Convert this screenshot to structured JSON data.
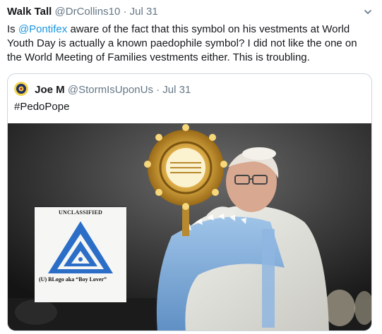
{
  "tweet": {
    "author_name": "Walk Tall",
    "author_handle": "@DrCollins10",
    "separator": "·",
    "date": "Jul 31",
    "text_before": "Is ",
    "mention": "@Pontifex",
    "text_after": " aware of the fact that this symbol on his vestments at World Youth Day is actually a known paedophile symbol? I did not like the one on the World Meeting of Families vestments either. This is troubling."
  },
  "quoted": {
    "author_name": "Joe M",
    "author_handle": "@StormIsUponUs",
    "separator": "·",
    "date": "Jul 31",
    "text": "#PedoPope",
    "image": {
      "placard_top": "UNCLASSIFIED",
      "placard_bottom": "(U) BLogo aka “Boy Lover”",
      "symbol_color": "#2b6ec8"
    }
  },
  "colors": {
    "link": "#1b95e0",
    "secondary_text": "#657786",
    "border": "#ccd6dd"
  },
  "icons": [
    "chevron-down-icon",
    "avatar"
  ]
}
